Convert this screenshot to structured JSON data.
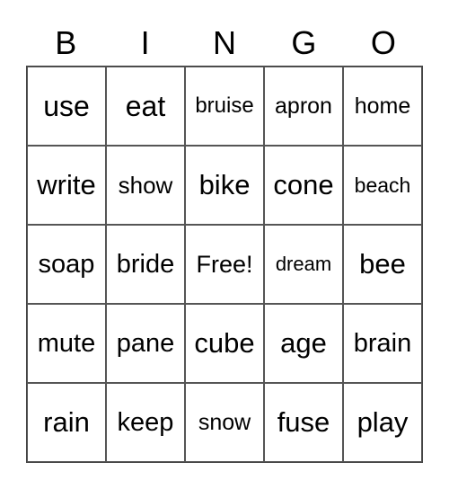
{
  "header": [
    "B",
    "I",
    "N",
    "G",
    "O"
  ],
  "cells": [
    [
      "use",
      "eat",
      "bruise",
      "apron",
      "home"
    ],
    [
      "write",
      "show",
      "bike",
      "cone",
      "beach"
    ],
    [
      "soap",
      "bride",
      "Free!",
      "dream",
      "bee"
    ],
    [
      "mute",
      "pane",
      "cube",
      "age",
      "brain"
    ],
    [
      "rain",
      "keep",
      "snow",
      "fuse",
      "play"
    ]
  ]
}
